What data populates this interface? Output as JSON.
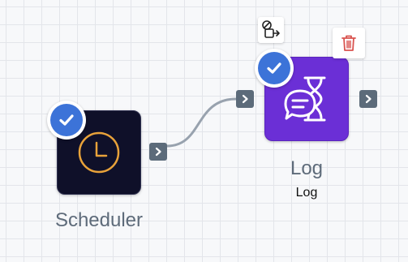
{
  "canvas": {
    "background": "#f7f8fa",
    "grid_color": "#e3e5ea"
  },
  "nodes": [
    {
      "id": "scheduler",
      "label": "Scheduler",
      "icon": "clock-icon",
      "background": "#0f1029",
      "icon_color": "#e8a23a",
      "selected": true
    },
    {
      "id": "log",
      "label": "Log",
      "sublabel": "Log",
      "icon": "chat-hourglass-icon",
      "background": "#6b2fd6",
      "icon_color": "#ffffff",
      "selected": true
    }
  ],
  "connection": {
    "from": "scheduler",
    "to": "log",
    "color": "#98a2ae"
  },
  "toolbar": {
    "skip_icon": "skip-node-icon",
    "delete_icon": "trash-icon",
    "delete_color": "#d9534f"
  },
  "colors": {
    "check_badge": "#3c73d8",
    "port": "#5c6b7a",
    "label": "#5e6b7a"
  }
}
